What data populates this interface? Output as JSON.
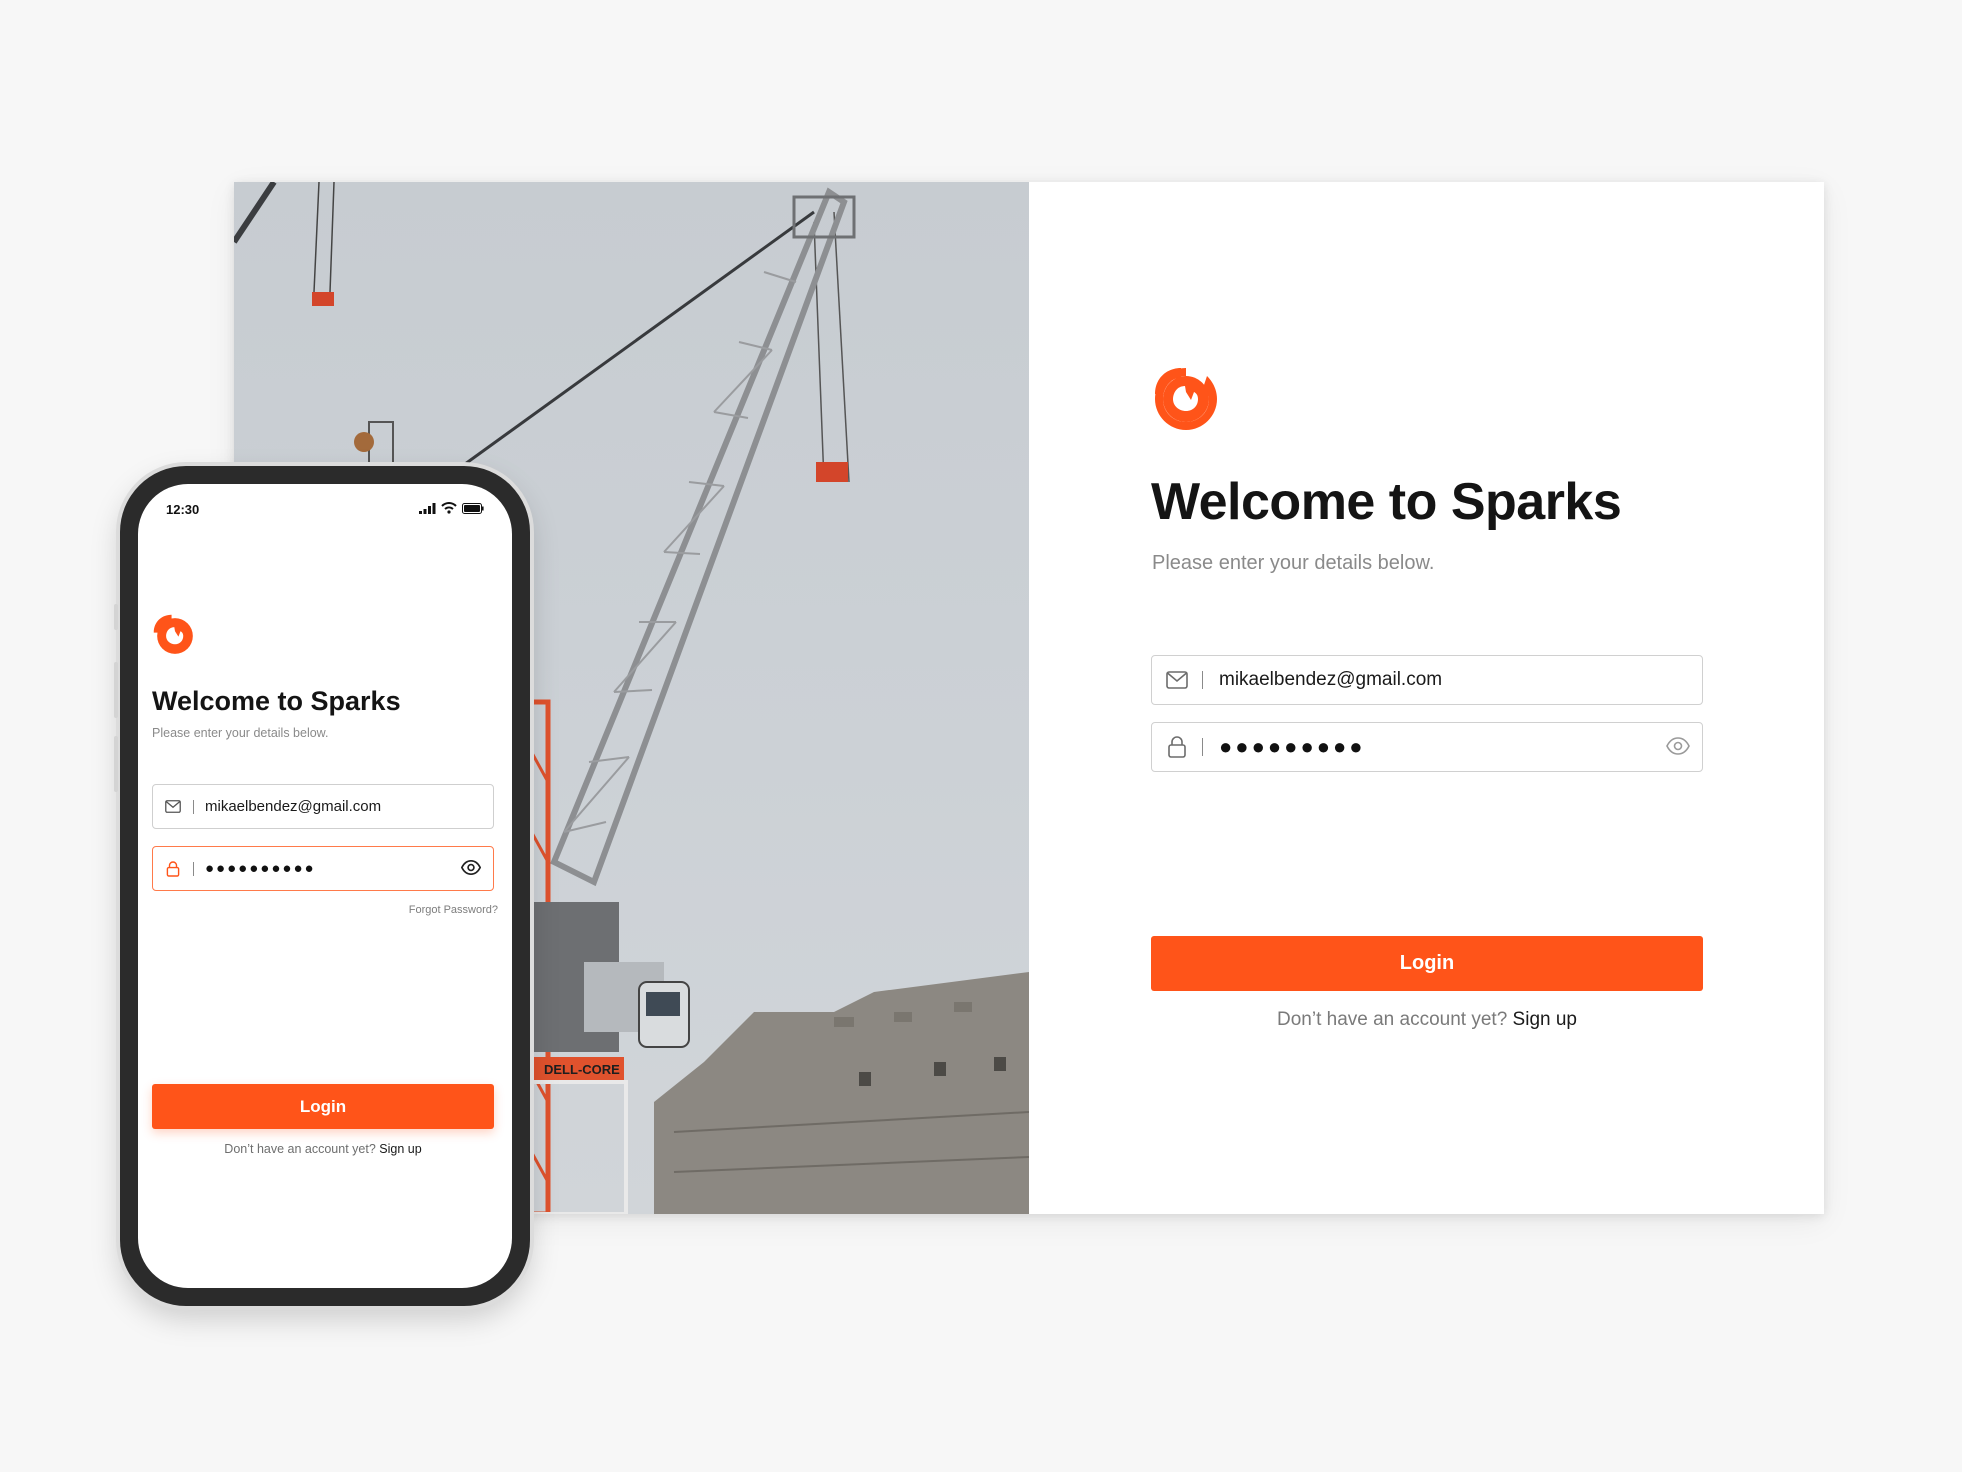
{
  "brand": {
    "accent": "#ff5419",
    "logo_icon": "sparks-logo-icon"
  },
  "desktop": {
    "title": "Welcome to Sparks",
    "subtitle": "Please enter your details below.",
    "email_value": "mikaelbendez@gmail.com",
    "password_mask": "●●●●●●●●●",
    "login_label": "Login",
    "signup_prompt": "Don’t have an account yet?",
    "signup_link": "Sign up",
    "icons": {
      "email": "mail-icon",
      "password": "lock-icon",
      "reveal": "eye-icon"
    }
  },
  "mobile": {
    "status_time": "12:30",
    "status_icons": [
      "signal-icon",
      "wifi-icon",
      "battery-icon"
    ],
    "title": "Welcome to Sparks",
    "subtitle": "Please enter your details below.",
    "email_value": "mikaelbendez@gmail.com",
    "password_mask": "●●●●●●●●●●",
    "forgot_label": "Forgot Password?",
    "login_label": "Login",
    "signup_prompt": "Don’t have an account yet?",
    "signup_link": "Sign up"
  },
  "photo": {
    "crane_sign_text": "DELL-CORE"
  }
}
